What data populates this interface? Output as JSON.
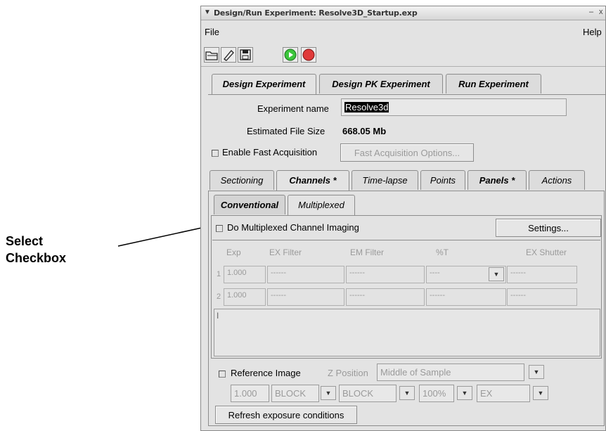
{
  "annotation": {
    "line1": "Select",
    "line2": "Checkbox"
  },
  "window": {
    "title": "Design/Run Experiment: Resolve3D_Startup.exp",
    "title_menu_glyph": "▼",
    "minimize_glyph": "‒",
    "close_glyph": "x"
  },
  "menubar": {
    "file": "File",
    "help": "Help"
  },
  "toolbar": {
    "open_icon": "open-folder-icon",
    "edit_icon": "pencil-icon",
    "save_icon": "floppy-disk-icon",
    "run_icon": "play-icon",
    "stop_icon": "record-stop-icon",
    "run_color": "#3cc63c",
    "stop_color": "#e03a3a"
  },
  "main_tabs": [
    {
      "label": "Design Experiment"
    },
    {
      "label": "Design PK Experiment"
    },
    {
      "label": "Run Experiment"
    }
  ],
  "experiment": {
    "name_label": "Experiment name",
    "name_value": "Resolve3d",
    "size_label": "Estimated File Size",
    "size_value": "668.05 Mb",
    "fast_label": "Enable Fast Acquisition",
    "fast_options": "Fast Acquisition Options..."
  },
  "sub_tabs": [
    {
      "label": "Sectioning"
    },
    {
      "label": "Channels *"
    },
    {
      "label": "Time-lapse"
    },
    {
      "label": "Points"
    },
    {
      "label": "Panels *"
    },
    {
      "label": "Actions"
    }
  ],
  "channel_tabs": [
    {
      "label": "Conventional"
    },
    {
      "label": "Multiplexed"
    }
  ],
  "multiplexed": {
    "checkbox_label": "Do Multiplexed Channel Imaging",
    "settings_button": "Settings..."
  },
  "table": {
    "headers": [
      "Exp",
      "EX Filter",
      "EM Filter",
      "%T",
      "EX Shutter"
    ],
    "rows": [
      {
        "num": "1",
        "exp": "1.000",
        "ex": "------",
        "em": "------",
        "t": "----",
        "shutter": "------"
      },
      {
        "num": "2",
        "exp": "1.000",
        "ex": "------",
        "em": "------",
        "t": "------",
        "shutter": "------"
      }
    ]
  },
  "notes_cursor": "I",
  "reference": {
    "label": "Reference Image",
    "zpos_label": "Z Position",
    "zpos_value": "Middle of Sample",
    "exp": "1.000",
    "ex_filter": "BLOCK",
    "em_filter": "BLOCK",
    "t": "100%",
    "shutter": "EX"
  },
  "refresh_button": "Refresh exposure conditions"
}
